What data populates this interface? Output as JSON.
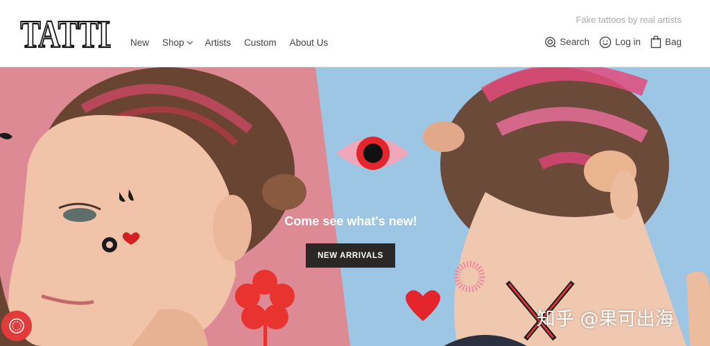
{
  "brand": {
    "logo_text": "TATTLY",
    "tagline": "Fake tattoos by real artists"
  },
  "nav": {
    "items": [
      {
        "label": "New"
      },
      {
        "label": "Shop",
        "has_dropdown": true
      },
      {
        "label": "Artists"
      },
      {
        "label": "Custom"
      },
      {
        "label": "About Us"
      }
    ]
  },
  "utilities": {
    "search": {
      "label": "Search",
      "icon": "search-icon"
    },
    "login": {
      "label": "Log in",
      "icon": "smiley-icon"
    },
    "bag": {
      "label": "Bag",
      "icon": "bag-icon"
    }
  },
  "hero": {
    "headline": "Come see what's new!",
    "cta_label": "NEW ARRIVALS",
    "colors": {
      "left_panel": "#dd8a95",
      "right_panel": "#9cc6e4",
      "cta_bg": "#2b2727"
    }
  },
  "chat": {
    "icon": "chat-icon"
  },
  "watermark": "知乎 @果可出海"
}
